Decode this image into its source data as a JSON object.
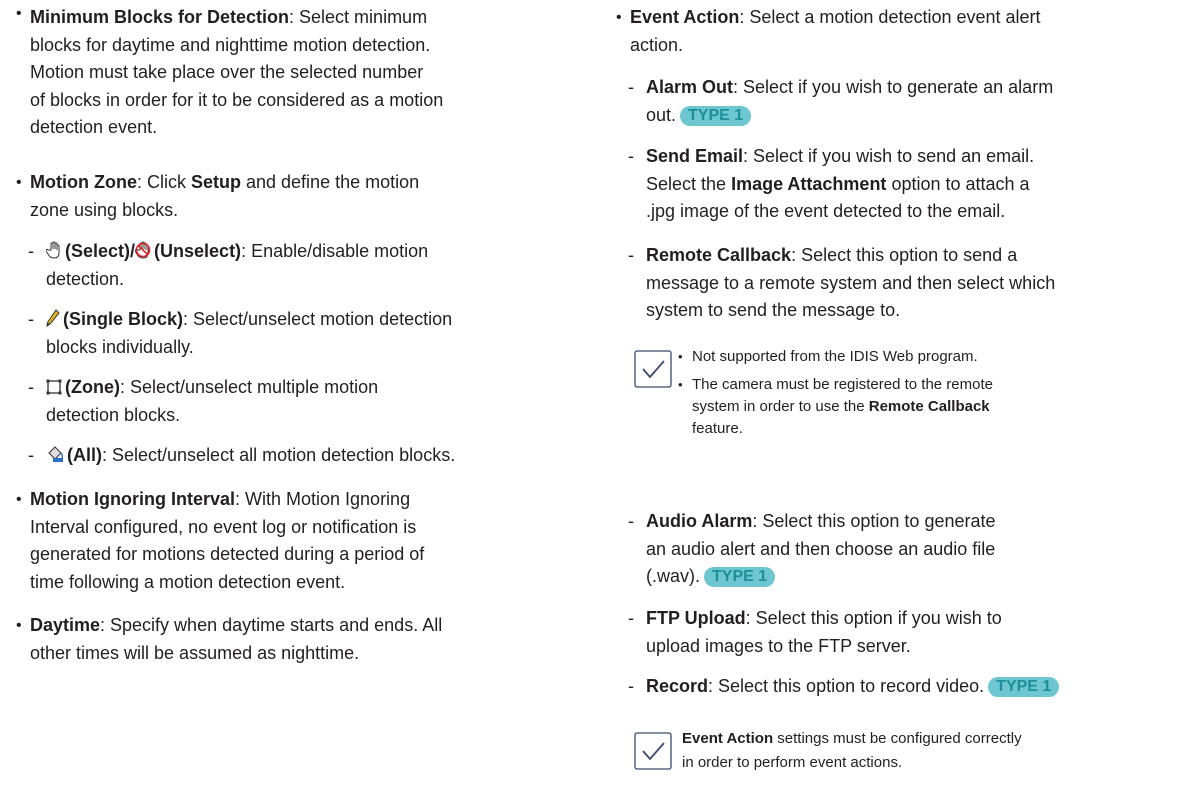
{
  "left": {
    "min_blocks": {
      "title": "Minimum Blocks for Detection",
      "l1": ": Select minimum",
      "l2": "blocks for daytime and nighttime motion detection.",
      "l3": "Motion must take place over the selected number",
      "l4": "of blocks in order for it to be considered as a motion",
      "l5": "detection event."
    },
    "motion_zone": {
      "title": "Motion Zone",
      "text1": ": Click ",
      "setup": "Setup",
      "text2": " and define the motion",
      "l2": "zone using blocks.",
      "items": [
        {
          "bold": "(Select)/",
          "bold2": "(Unselect)",
          "rest": ": Enable/disable motion",
          "l2": "detection."
        },
        {
          "bold": "(Single Block)",
          "rest": ": Select/unselect motion detection",
          "l2": "blocks individually."
        },
        {
          "bold": "(Zone)",
          "rest": ": Select/unselect multiple motion",
          "l2": "detection blocks."
        },
        {
          "bold": "(All)",
          "rest": ": Select/unselect all motion detection blocks."
        }
      ]
    },
    "ignoring": {
      "title": "Motion Ignoring Interval",
      "l1": ": With Motion Ignoring",
      "l2": "Interval configured, no event log or notification is",
      "l3": "generated for motions detected during a period of",
      "l4": "time following a motion detection event."
    },
    "daytime": {
      "title": "Daytime",
      "l1": ": Specify when daytime starts and ends. All",
      "l2": "other times will be assumed as nighttime."
    }
  },
  "right": {
    "event_action": {
      "title": "Event Action",
      "l1": ": Select a motion detection event alert",
      "l2": "action."
    },
    "alarm_out": {
      "title": "Alarm Out",
      "l1": ": Select if you wish to generate an alarm",
      "l2": "out.",
      "badge": "TYPE 1"
    },
    "send_email": {
      "title": "Send Email",
      "l1": ": Select if you wish to send an email.",
      "l2a": "Select the ",
      "l2b": "Image Attachment",
      "l2c": " option to attach a",
      "l3": ".jpg image of the event detected to the email."
    },
    "remote_callback": {
      "title": "Remote Callback",
      "l1": ": Select this option to send a",
      "l2": "message to a remote system and then select which",
      "l3": "system to send the message to."
    },
    "note1": {
      "i1": "Not supported from the IDIS Web program.",
      "i2l1": "The camera must be registered to the remote",
      "i2l2a": "system in order to use the ",
      "i2l2b": "Remote Callback",
      "i2l3": "feature."
    },
    "audio_alarm": {
      "title": "Audio Alarm",
      "l1": ": Select this option to generate",
      "l2": "an audio alert and then choose an audio file",
      "l3": "(.wav).",
      "badge": "TYPE 1"
    },
    "ftp": {
      "title": "FTP Upload",
      "l1": ": Select this option if you wish to",
      "l2": "upload images to the FTP server."
    },
    "record": {
      "title": "Record",
      "l1": ": Select this option to record video.",
      "badge": "TYPE 1"
    },
    "note2": {
      "bold": "Event Action",
      "l1": " settings must be configured correctly",
      "l2": "in order to perform event actions."
    }
  },
  "colors": {
    "badge_bg": "#6ec7d0",
    "badge_text": "#1d8f99",
    "text": "#231f20",
    "check": "#3b4a6b"
  },
  "icons": [
    "hand-select-icon",
    "hand-unselect-icon",
    "pencil-icon",
    "zone-rect-icon",
    "paint-bucket-icon",
    "checkmark-icon"
  ]
}
